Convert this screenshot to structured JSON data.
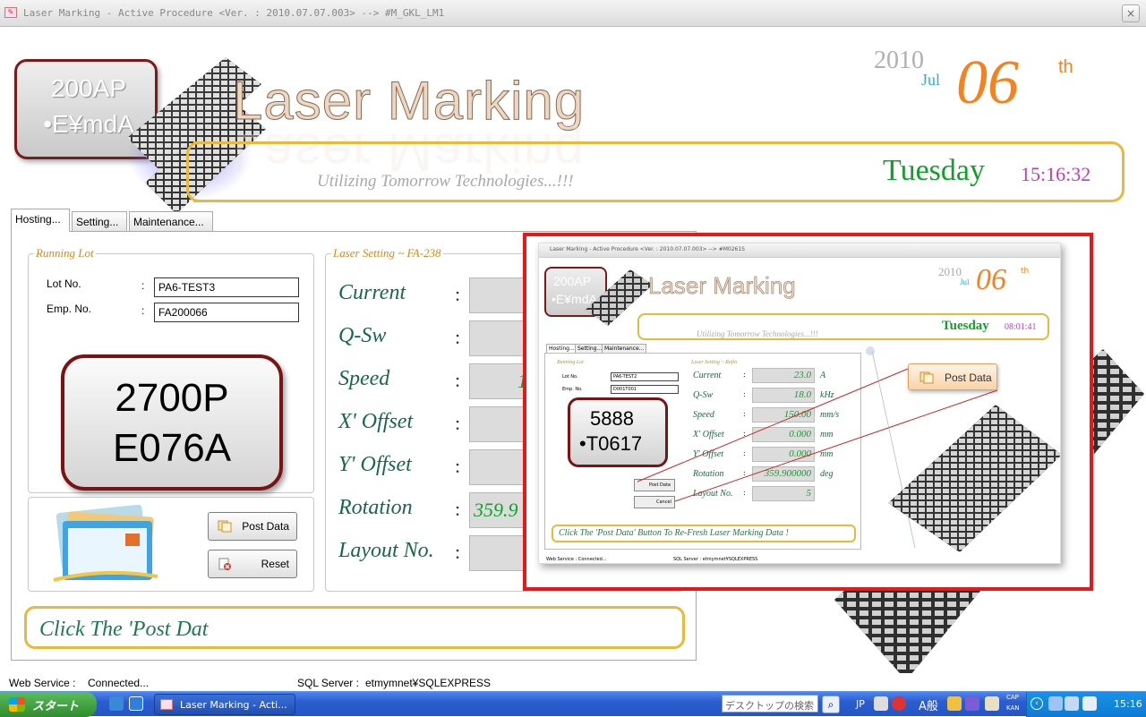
{
  "window": {
    "title": "Laser Marking - Active Procedure <Ver. : 2010.07.07.003> --> #M_GKL_LM1",
    "close_label": "×"
  },
  "header": {
    "logo_line1": "200AP",
    "logo_line2": "•E¥mdA",
    "brand_title": "Laser Marking",
    "tagline": "Utilizing Tomorrow Technologies...!!!",
    "date": {
      "year": "2010",
      "month": "Jul",
      "day": "06",
      "suffix": "th",
      "weekday": "Tuesday",
      "time": "15:16:32"
    }
  },
  "tabs": [
    {
      "label": "Hosting..."
    },
    {
      "label": "Setting..."
    },
    {
      "label": "Maintenance..."
    }
  ],
  "running_lot": {
    "title": "Running Lot",
    "lot_no_label": "Lot No.",
    "emp_no_label": "Emp. No.",
    "colon": ":",
    "lot_no_value": "PA6-TEST3",
    "emp_no_value": "FA200066",
    "plate_line1": "2700P",
    "plate_line2": "E076A"
  },
  "actions": {
    "post_label": "Post Data",
    "reset_label": "Reset"
  },
  "laser_setting": {
    "title": "Laser Setting ~ FA-238",
    "colon": ":",
    "rows": [
      {
        "label": "Current",
        "value": ""
      },
      {
        "label": "Q-Sw",
        "value": ""
      },
      {
        "label": "Speed",
        "value": "1"
      },
      {
        "label": "X' Offset",
        "value": ""
      },
      {
        "label": "Y' Offset",
        "value": ""
      },
      {
        "label": "Rotation",
        "value": "359.9"
      },
      {
        "label": "Layout No.",
        "value": ""
      }
    ]
  },
  "message": "Click The 'Post Dat",
  "status": {
    "web_label": "Web Service :",
    "web_value": "Connected...",
    "sql_label": "SQL Server :",
    "sql_value": "etmymnet¥SQLEXPRESS"
  },
  "preview": {
    "title": "Laser Marking - Active Procedure <Ver. : 2010.07.07.003> --> #M0261S",
    "logo_line1": "200AP",
    "logo_line2": "•E¥mdA",
    "brand_title": "Laser Marking",
    "tagline": "Utilizing Tomorrow Technologies...!!!",
    "year": "2010",
    "month": "Jul",
    "day": "06",
    "suffix": "th",
    "weekday": "Tuesday",
    "time": "08:01:41",
    "tabs": [
      "Hosting...",
      "Setting...",
      "Maintenance..."
    ],
    "running_lot_title": "Running Lot",
    "lot_no_label": "Lot No.",
    "emp_no_label": "Emp. No.",
    "lot_no_value": "PA6-TEST2",
    "emp_no_value": "D001T001",
    "plate_line1": "5888",
    "plate_line2": "•T0617",
    "post_label": "Post Data",
    "cancel_label": "Cancel",
    "laser_setting_title": "Laser Setting ~ Rofin",
    "rows": [
      {
        "label": "Current",
        "value": "23.0",
        "unit": "A"
      },
      {
        "label": "Q-Sw",
        "value": "18.0",
        "unit": "kHz"
      },
      {
        "label": "Speed",
        "value": "150.00",
        "unit": "mm/s"
      },
      {
        "label": "X' Offset",
        "value": "0.000",
        "unit": "mm"
      },
      {
        "label": "Y' Offset",
        "value": "0.000",
        "unit": "mm"
      },
      {
        "label": "Rotation",
        "value": "359.900000",
        "unit": "deg"
      },
      {
        "label": "Layout No.",
        "value": "5",
        "unit": ""
      }
    ],
    "message": "Click The 'Post Data' Button To Re-Fresh Laser Marking Data !",
    "callout_post_label": "Post Data",
    "web_status": "Web Service :   Connected...",
    "sql_status": "SQL Server :   etmymnet¥SQLEXPRESS"
  },
  "taskbar": {
    "start_label": "スタート",
    "task_label": "Laser Marking - Acti...",
    "search_placeholder": "デスクトップの検索",
    "lang": "JP",
    "ime_label": "A般",
    "caps_label": "CAP",
    "kana_label": "KAN",
    "clock": "15:16"
  },
  "colors": {
    "accent_orange": "#f5821f",
    "weekday_green": "#12a02a",
    "time_magenta": "#c13bb8",
    "banner_gold": "#e8b93a",
    "highlight_red": "#e81818"
  }
}
